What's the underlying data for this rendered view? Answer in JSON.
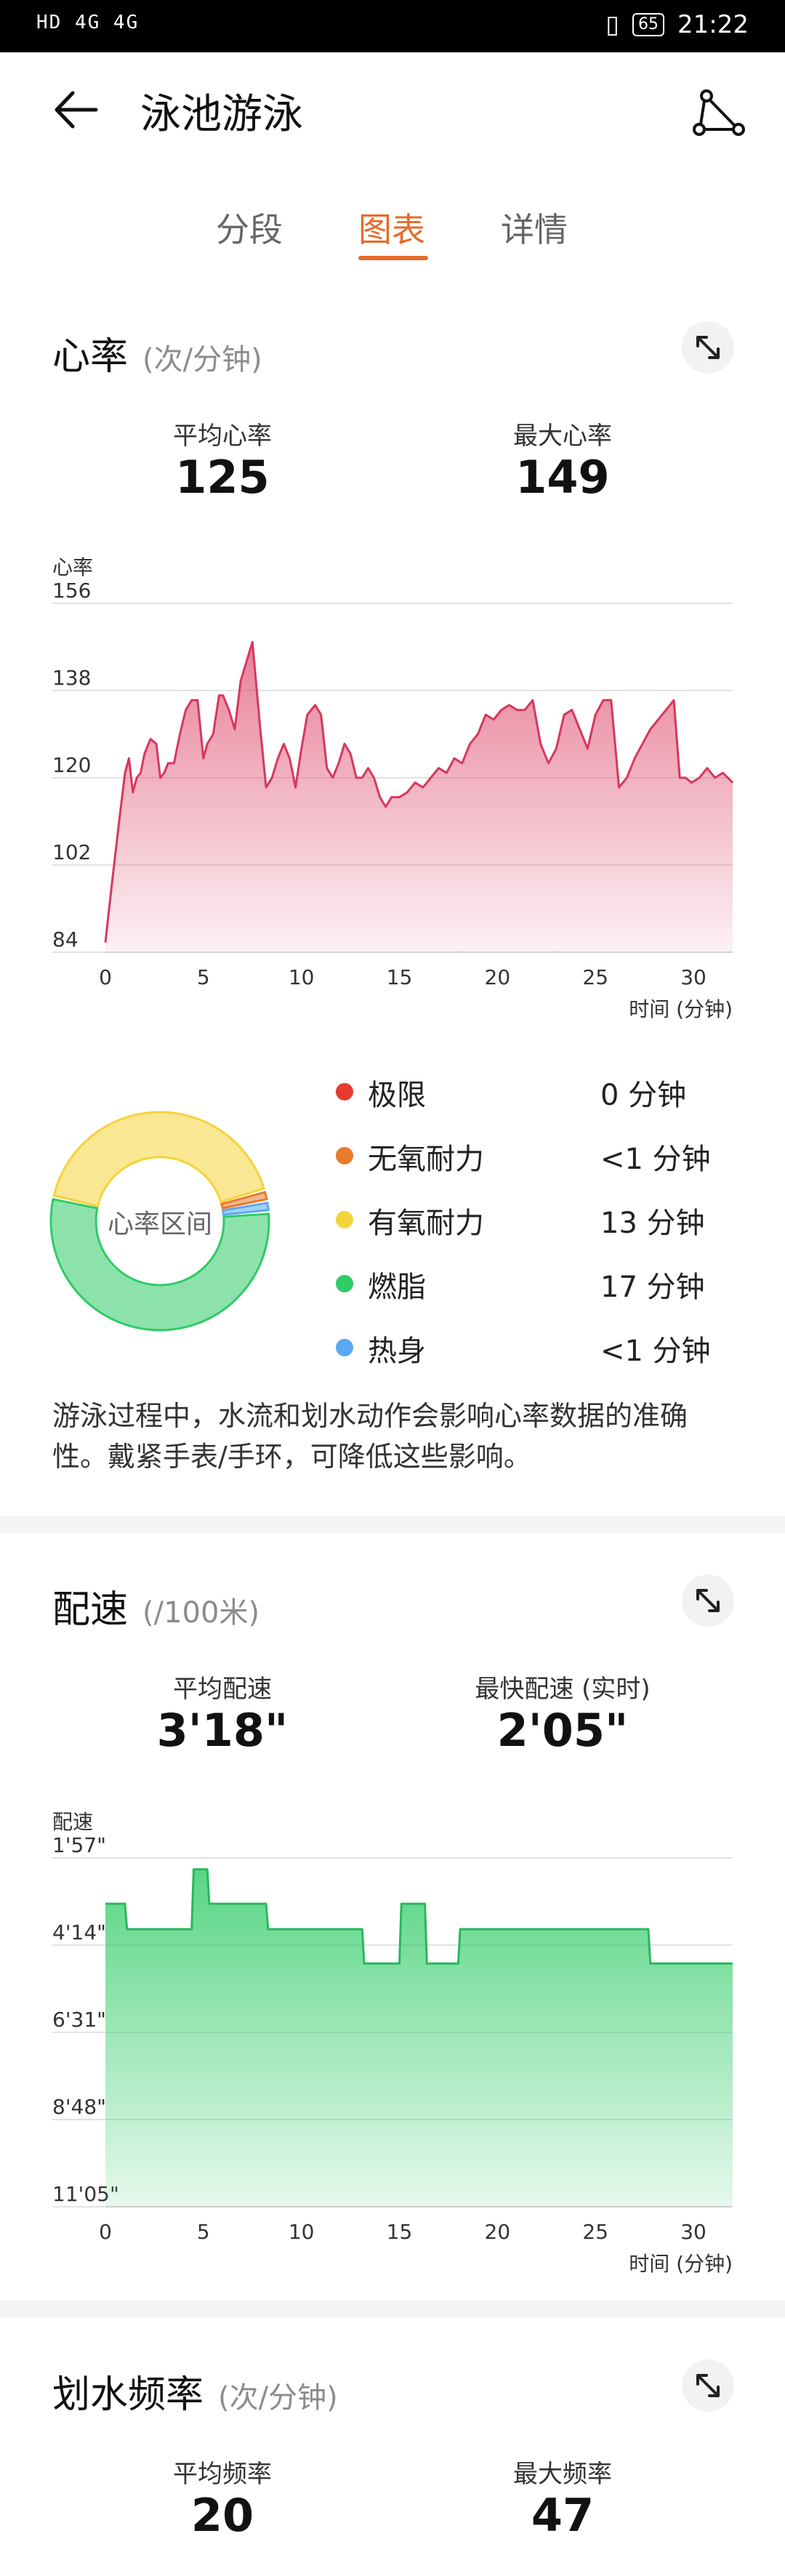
{
  "status_bar": {
    "left": "HD 4G 4G",
    "battery": "65",
    "time": "21:22"
  },
  "header": {
    "title": "泳池游泳"
  },
  "tabs": [
    {
      "label": "分段",
      "active": false
    },
    {
      "label": "图表",
      "active": true
    },
    {
      "label": "详情",
      "active": false
    }
  ],
  "heart_rate": {
    "title": "心率",
    "unit": "(次/分钟)",
    "avg_label": "平均心率",
    "avg_value": "125",
    "max_label": "最大心率",
    "max_value": "149",
    "ylabel": "心率",
    "xlabel": "时间 (分钟)",
    "donut_center": "心率区间",
    "zones": [
      {
        "label": "极限",
        "value": "0 分钟",
        "color": "#e83a2e"
      },
      {
        "label": "无氧耐力",
        "value": "<1 分钟",
        "color": "#ea7a2c"
      },
      {
        "label": "有氧耐力",
        "value": "13 分钟",
        "color": "#f5d33a"
      },
      {
        "label": "燃脂",
        "value": "17 分钟",
        "color": "#2fcb66"
      },
      {
        "label": "热身",
        "value": "<1 分钟",
        "color": "#5aa8f0"
      }
    ],
    "note": "游泳过程中，水流和划水动作会影响心率数据的准确性。戴紧手表/手环，可降低这些影响。"
  },
  "pace": {
    "title": "配速",
    "unit": "(/100米)",
    "avg_label": "平均配速",
    "avg_value": "3'18\"",
    "best_label": "最快配速 (实时)",
    "best_value": "2'05\"",
    "ylabel": "配速",
    "xlabel": "时间 (分钟)"
  },
  "stroke": {
    "title": "划水频率",
    "unit": "(次/分钟)",
    "avg_label": "平均频率",
    "avg_value": "20",
    "max_label": "最大频率",
    "max_value": "47"
  },
  "chart_data": [
    {
      "type": "area",
      "title": "心率",
      "xlabel": "时间 (分钟)",
      "ylabel": "心率",
      "xlim": [
        0,
        32
      ],
      "ylim": [
        84,
        156
      ],
      "xticks": [
        0,
        5,
        10,
        15,
        20,
        25,
        30
      ],
      "yticks": [
        156,
        138,
        120,
        102,
        84
      ],
      "color": "#e05576",
      "x": [
        0,
        0.3,
        0.7,
        1.0,
        1.2,
        1.4,
        1.6,
        1.8,
        2.0,
        2.3,
        2.6,
        2.8,
        3.0,
        3.2,
        3.5,
        3.8,
        4.1,
        4.4,
        4.7,
        5.0,
        5.2,
        5.5,
        5.8,
        6.0,
        6.3,
        6.6,
        6.9,
        7.2,
        7.5,
        7.9,
        8.2,
        8.5,
        8.8,
        9.1,
        9.4,
        9.7,
        10.0,
        10.3,
        10.7,
        11.0,
        11.3,
        11.6,
        11.9,
        12.2,
        12.5,
        12.8,
        13.1,
        13.4,
        13.7,
        14.0,
        14.3,
        14.6,
        15.0,
        15.4,
        15.8,
        16.2,
        16.6,
        17.0,
        17.4,
        17.8,
        18.2,
        18.6,
        19.0,
        19.4,
        19.8,
        20.2,
        20.6,
        21.0,
        21.4,
        21.8,
        22.2,
        22.6,
        23.0,
        23.4,
        23.8,
        24.2,
        24.6,
        25.0,
        25.4,
        25.8,
        26.2,
        26.6,
        27.0,
        27.4,
        27.8,
        28.2,
        28.6,
        29.0,
        29.3,
        29.6,
        29.9,
        30.3,
        30.7,
        31.1,
        31.5,
        32.0
      ],
      "y": [
        86,
        97,
        111,
        121,
        124,
        117,
        120,
        121,
        125,
        128,
        127,
        120,
        121,
        123,
        123,
        129,
        134,
        136,
        136,
        124,
        127,
        129,
        137,
        137,
        134,
        130,
        140,
        144,
        148,
        130,
        118,
        120,
        124,
        127,
        124,
        118,
        126,
        133,
        135,
        133,
        122,
        120,
        123,
        127,
        125,
        120,
        120,
        122,
        120,
        116,
        114,
        116,
        116,
        117,
        119,
        118,
        120,
        122,
        121,
        124,
        123,
        127,
        129,
        133,
        132,
        134,
        135,
        134,
        134,
        136,
        127,
        123,
        126,
        133,
        134,
        130,
        126,
        133,
        136,
        136,
        118,
        120,
        124,
        127,
        130,
        132,
        134,
        136,
        120,
        120,
        119,
        120,
        122,
        120,
        121,
        119,
        120
      ]
    },
    {
      "type": "area",
      "title": "配速",
      "xlabel": "时间 (分钟)",
      "ylabel": "配速",
      "xlim": [
        0,
        32
      ],
      "ylim": [
        "11'05\"",
        "1'57\""
      ],
      "xticks": [
        0,
        5,
        10,
        15,
        20,
        25,
        30
      ],
      "yticks": [
        "1'57\"",
        "4'14\"",
        "6'31\"",
        "8'48\"",
        "11'05\""
      ],
      "color": "#2fcb66",
      "x": [
        0,
        1.0,
        1.1,
        4.4,
        4.5,
        5.2,
        5.3,
        8.2,
        8.3,
        13.1,
        13.2,
        15.0,
        15.1,
        16.3,
        16.4,
        18.0,
        18.1,
        27.7,
        27.8,
        32.0
      ],
      "y": [
        "3'09\"",
        "3'09\"",
        "3'49\"",
        "3'49\"",
        "2'15\"",
        "2'15\"",
        "3'09\"",
        "3'09\"",
        "3'49\"",
        "3'49\"",
        "4'43\"",
        "4'43\"",
        "3'09\"",
        "3'09\"",
        "4'43\"",
        "4'43\"",
        "3'49\"",
        "3'49\"",
        "4'43\"",
        "4'43\""
      ]
    },
    {
      "type": "pie",
      "title": "心率区间",
      "labels": [
        "极限",
        "无氧耐力",
        "有氧耐力",
        "燃脂",
        "热身"
      ],
      "values": [
        0,
        0.5,
        13,
        17,
        0.5
      ],
      "colors": [
        "#e83a2e",
        "#ea7a2c",
        "#f5d33a",
        "#2fcb66",
        "#5aa8f0"
      ]
    }
  ]
}
